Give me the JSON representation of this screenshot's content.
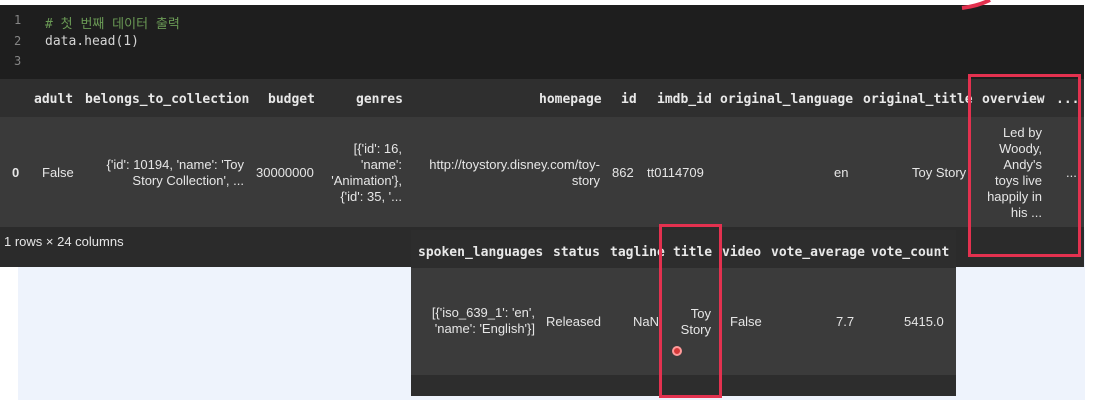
{
  "code_cell": {
    "lines": [
      {
        "number": "1",
        "text": "# 첫 번째 데이터 출력"
      },
      {
        "number": "2",
        "text": "data.head(1)"
      },
      {
        "number": "3",
        "text": ""
      }
    ]
  },
  "output_table": {
    "headers": {
      "adult": "adult",
      "belongs_to_collection": "belongs_to_collection",
      "budget": "budget",
      "genres": "genres",
      "homepage": "homepage",
      "id": "id",
      "imdb_id": "imdb_id",
      "original_language": "original_language",
      "original_title": "original_title",
      "overview": "overview",
      "ellipsis": "..."
    },
    "row": {
      "index": "0",
      "adult": "False",
      "belongs_to_collection": "{'id': 10194, 'name': 'Toy Story Collection', ...",
      "budget": "30000000",
      "genres": "[{'id': 16, 'name': 'Animation'}, {'id': 35, '...",
      "homepage": "http://toystory.disney.com/toy-story",
      "id": "862",
      "imdb_id": "tt0114709",
      "original_language": "en",
      "original_title": "Toy Story",
      "overview": "Led by Woody, Andy's toys live happily in his ...",
      "ellipsis": "..."
    },
    "shape": "1 rows × 24 columns"
  },
  "continued_table": {
    "headers": {
      "spoken_languages": "spoken_languages",
      "status": "status",
      "tagline": "tagline",
      "title": "title",
      "video": "video",
      "vote_average": "vote_average",
      "vote_count": "vote_count"
    },
    "row": {
      "spoken_languages": "[{'iso_639_1': 'en', 'name': 'English'}]",
      "status": "Released",
      "tagline": "NaN",
      "title": "Toy Story",
      "video": "False",
      "vote_average": "7.7",
      "vote_count": "5415.0"
    }
  },
  "colors": {
    "highlight": "#e3314f",
    "code_background": "#1e1e1e",
    "comment": "#6a9955"
  }
}
